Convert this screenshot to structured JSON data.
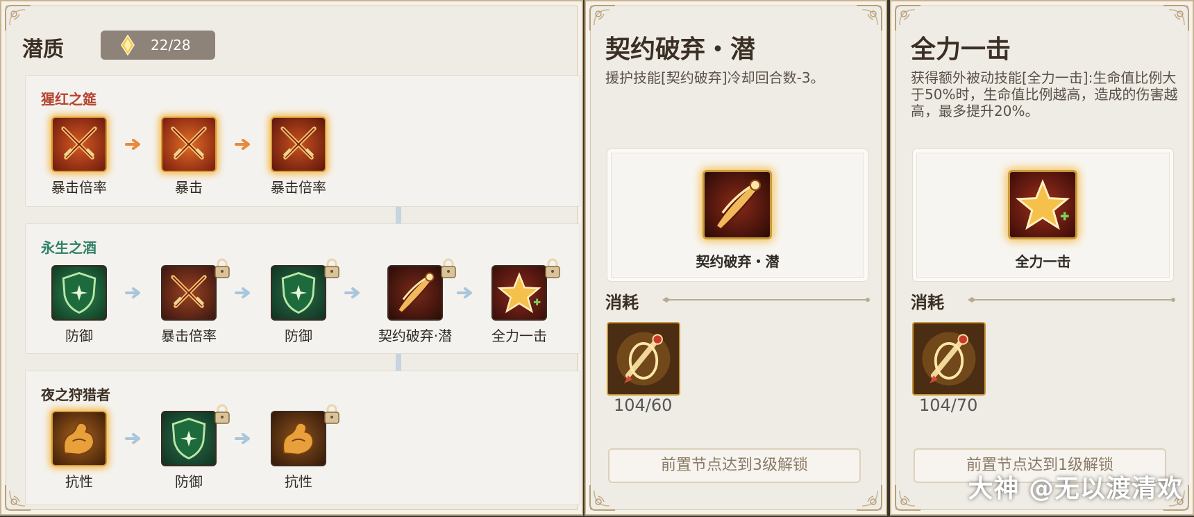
{
  "talent": {
    "title": "潜质",
    "counter": "22/28",
    "rows": [
      {
        "name": "猩红之筵",
        "name_color": "#b4442f",
        "nodes": [
          {
            "label": "暴击倍率",
            "icon": "crossed-swords-icon"
          },
          {
            "label": "暴击",
            "icon": "crossed-swords-icon"
          },
          {
            "label": "暴击倍率",
            "icon": "crossed-swords-icon"
          }
        ]
      },
      {
        "name": "永生之酒",
        "name_color": "#2f8068",
        "nodes": [
          {
            "label": "防御",
            "icon": "shield-icon"
          },
          {
            "label": "暴击倍率",
            "icon": "crossed-swords-icon",
            "locked": true
          },
          {
            "label": "防御",
            "icon": "shield-icon",
            "locked": true
          },
          {
            "label": "契约破弃·潜",
            "icon": "contract-blade-icon",
            "locked": true
          },
          {
            "label": "全力一击",
            "icon": "star-icon",
            "locked": true
          }
        ]
      },
      {
        "name": "夜之狩猎者",
        "name_color": "#3b2f25",
        "nodes": [
          {
            "label": "抗性",
            "icon": "flexed-arm-icon"
          },
          {
            "label": "防御",
            "icon": "shield-icon",
            "locked": true
          },
          {
            "label": "抗性",
            "icon": "flexed-arm-icon",
            "locked": true
          }
        ]
      }
    ]
  },
  "detail_left": {
    "title": "契约破弃・潜",
    "description": "援护技能[契约破弃]冷却回合数-3。",
    "skill_name": "契约破弃・潜",
    "cost_label": "消耗",
    "quantity": "104/60",
    "unlock_text": "前置节点达到3级解锁"
  },
  "detail_right": {
    "title": "全力一击",
    "description": "获得额外被动技能[全力一击]:生命值比例大于50%时，生命值比例越高，造成的伤害越高，最多提升20%。",
    "skill_name": "全力一击",
    "cost_label": "消耗",
    "quantity": "104/70",
    "unlock_text": "前置节点达到1级解锁"
  },
  "watermark": "大神 @无以渡清欢"
}
